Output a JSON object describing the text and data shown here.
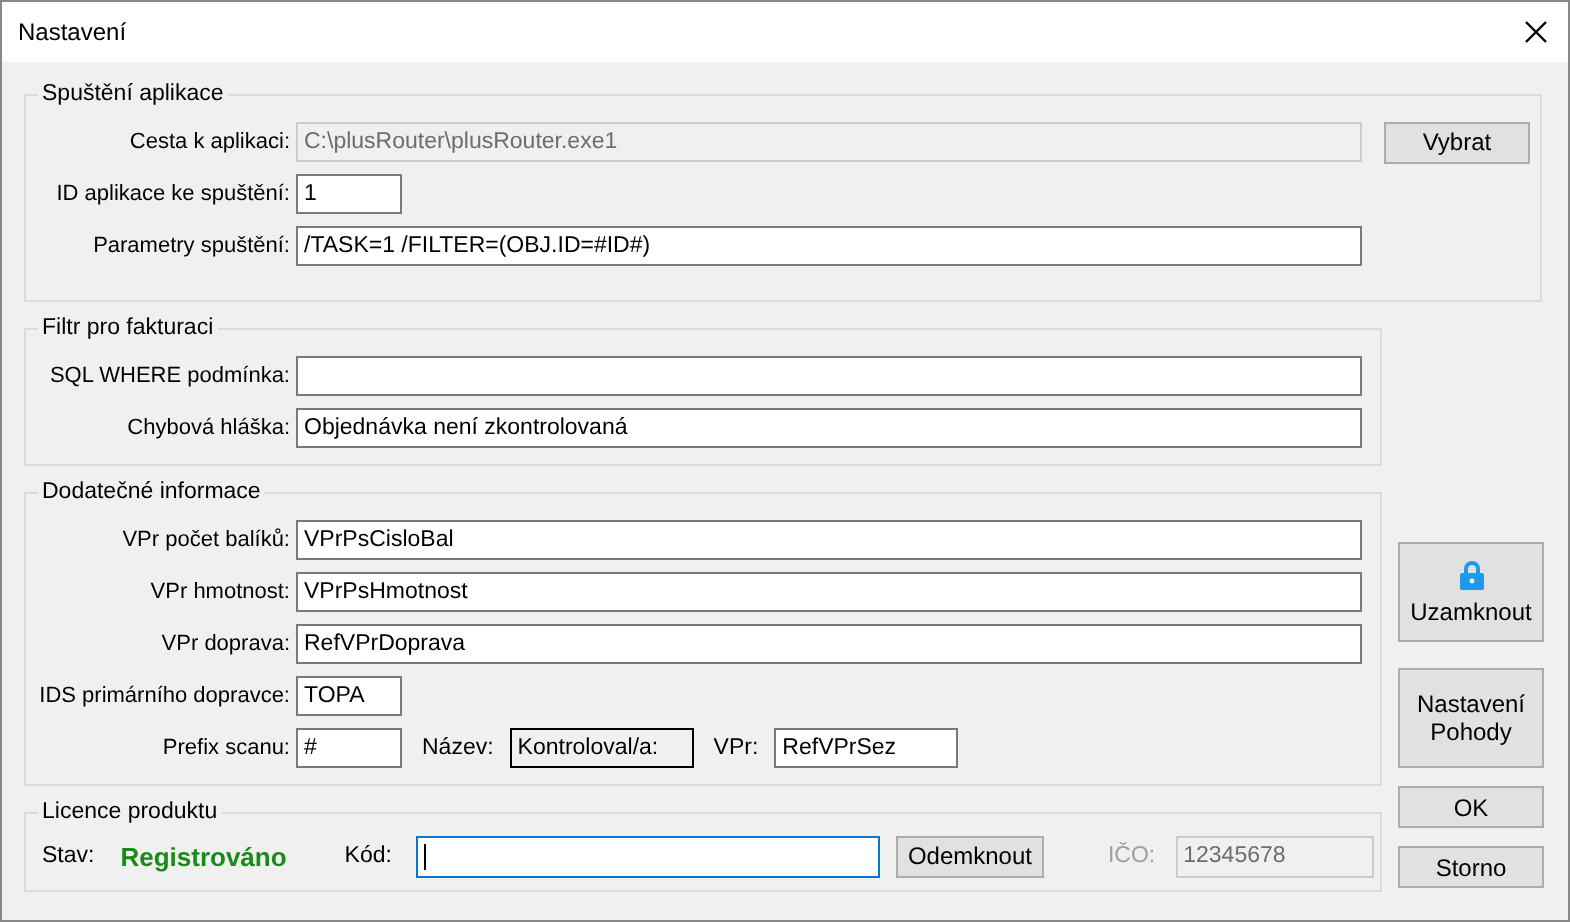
{
  "window": {
    "title": "Nastavení"
  },
  "groups": [
    {
      "title": "Spuštění aplikace",
      "rows": [
        {
          "label": "Cesta k aplikaci:",
          "value": "C:\\plusRouter\\plusRouter.exe1",
          "kind": "long",
          "disabled": true,
          "button": "Vybrat"
        },
        {
          "label": "ID aplikace ke spuštění:",
          "value": "1",
          "kind": "short",
          "disabled": false
        },
        {
          "label": "Parametry spuštění:",
          "value": "/TASK=1 /FILTER=(OBJ.ID=#ID#)",
          "kind": "long",
          "disabled": false
        }
      ]
    },
    {
      "title": "Filtr pro fakturaci",
      "rows": [
        {
          "label": "SQL WHERE podmínka:",
          "kind": "long",
          "disabled": false
        },
        {
          "label": "Chybová hláška:",
          "value": "Objednávka není zkontrolovaná",
          "kind": "long",
          "disabled": false
        }
      ]
    },
    {
      "title": "Dodatečné informace",
      "rows": [
        {
          "label": "VPr počet balíků:",
          "value": "VPrPsCisloBal",
          "kind": "long",
          "disabled": false
        },
        {
          "label": "VPr hmotnost:",
          "value": "VPrPsHmotnost",
          "kind": "long",
          "disabled": false
        },
        {
          "label": "VPr doprava:",
          "value": "RefVPrDoprava",
          "kind": "long",
          "disabled": false
        },
        {
          "label": "IDS primárního dopravce:",
          "value": "TOPA",
          "kind": "short",
          "disabled": false
        },
        {
          "label": "Prefix scanu:",
          "value": "#",
          "kind": "short",
          "disabled": false,
          "extras": [
            {
              "label": "Název:",
              "value": "Kontroloval/a:",
              "kind": "boxed"
            },
            {
              "label": "VPr:",
              "value": "RefVPrSez",
              "kind": "field"
            }
          ]
        }
      ]
    }
  ],
  "license": {
    "title": "Licence produktu",
    "status_label": "Stav:",
    "status": "Registrováno",
    "registered": true,
    "code_label": "Kód:",
    "code_focused": true,
    "unlock_button": "Odemknout",
    "ico_label": "IČO:",
    "ico": "12345678",
    "ico_disabled": true
  },
  "buttons": [
    {
      "label": "Uzamknout",
      "kind": "lock"
    },
    {
      "label": "Nastavení Pohody",
      "kind": "tall"
    },
    {
      "label": "OK",
      "kind": "small"
    },
    {
      "label": "Storno",
      "kind": "small"
    }
  ]
}
